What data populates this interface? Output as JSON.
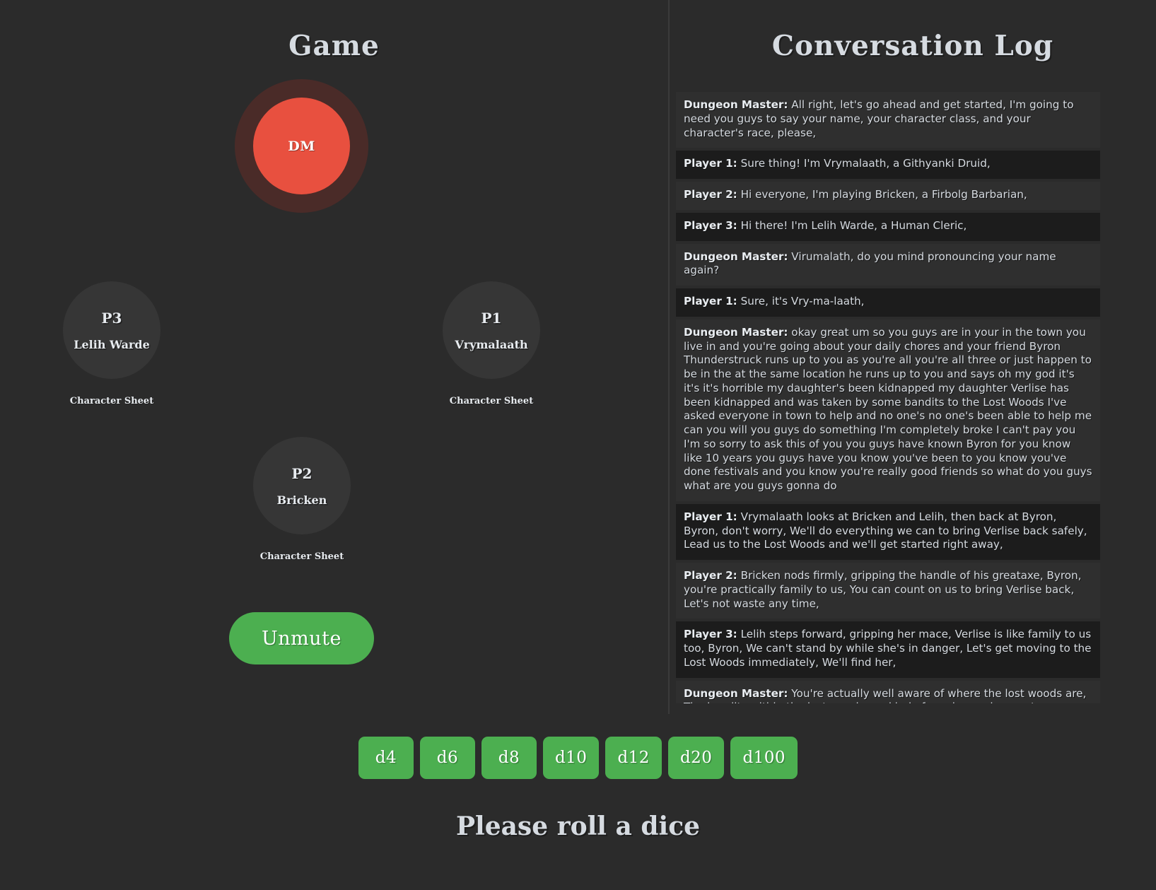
{
  "game": {
    "title": "Game",
    "dm": {
      "label": "DM"
    },
    "players": [
      {
        "id": "P3",
        "name": "Lelih Warde",
        "sheet_label": "Character Sheet"
      },
      {
        "id": "P1",
        "name": "Vrymalaath",
        "sheet_label": "Character Sheet"
      },
      {
        "id": "P2",
        "name": "Bricken",
        "sheet_label": "Character Sheet"
      }
    ],
    "unmute_label": "Unmute"
  },
  "log": {
    "title": "Conversation Log",
    "messages": [
      {
        "speaker": "Dungeon Master:",
        "text": " All right, let's go ahead and get started, I'm going to need you guys to say your name, your character class, and your character's race, please,"
      },
      {
        "speaker": "Player 1:",
        "text": " Sure thing! I'm Vrymalaath, a Githyanki Druid,"
      },
      {
        "speaker": "Player 2:",
        "text": " Hi everyone, I'm playing Bricken, a Firbolg Barbarian,"
      },
      {
        "speaker": "Player 3:",
        "text": " Hi there! I'm Lelih Warde, a Human Cleric,"
      },
      {
        "speaker": "Dungeon Master:",
        "text": " Virumalath, do you mind pronouncing your name again?"
      },
      {
        "speaker": "Player 1:",
        "text": " Sure, it's Vry-ma-laath,"
      },
      {
        "speaker": "Dungeon Master:",
        "text": " okay great um so you guys are in your in the town you live in and you're going about your daily chores and your friend Byron Thunderstruck runs up to you as you're all you're all three or just happen to be in the at the same location he runs up to you and says oh my god it's it's it's horrible my daughter's been kidnapped my daughter Verlise has been kidnapped and was taken by some bandits to the Lost Woods I've asked everyone in town to help and no one's no one's been able to help me can you will you guys do something I'm completely broke I can't pay you I'm so sorry to ask this of you you guys have known Byron for you know like 10 years you guys have you know you've been to you know you've done festivals and you know you're really good friends so what do you guys what are you guys gonna do"
      },
      {
        "speaker": "Player 1:",
        "text": " Vrymalaath looks at Bricken and Lelih, then back at Byron, Byron, don't worry, We'll do everything we can to bring Verlise back safely, Lead us to the Lost Woods and we'll get started right away,"
      },
      {
        "speaker": "Player 2:",
        "text": " Bricken nods firmly, gripping the handle of his greataxe, Byron, you're practically family to us, You can count on us to bring Verlise back, Let's not waste any time,"
      },
      {
        "speaker": "Player 3:",
        "text": " Lelih steps forward, gripping her mace, Verlise is like family to us too, Byron, We can't stand by while she's in danger, Let's get moving to the Lost Woods immediately, We'll find her,"
      },
      {
        "speaker": "Dungeon Master:",
        "text": " You're actually well aware of where the lost woods are, The bandits within the lost woods are kind of a nuisance in your town as well, So you know, no one in your town is going to, there's not going to be any love lost if anything happens to them, However, it's going to be"
      }
    ]
  },
  "dice": {
    "buttons": [
      "d4",
      "d6",
      "d8",
      "d10",
      "d12",
      "d20",
      "d100"
    ]
  },
  "status": {
    "roll_prompt": "Please roll a dice"
  },
  "colors": {
    "background": "#2b2b2b",
    "dm_accent": "#e8503f",
    "dm_ring": "#4a2b28",
    "green_accent": "#4caf50",
    "avatar": "#363636",
    "message_dark": "#1c1c1c",
    "message_light": "#2f2f2f"
  }
}
